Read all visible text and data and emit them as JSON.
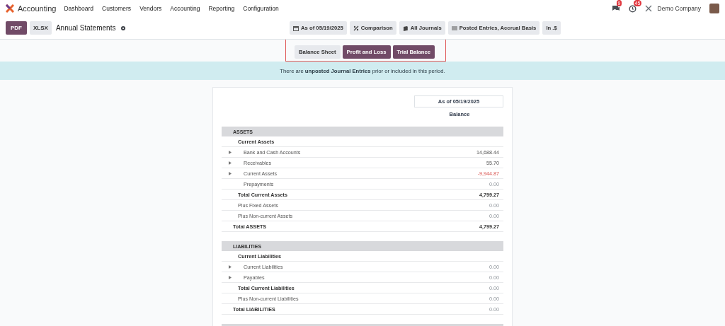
{
  "navbar": {
    "app_name": "Accounting",
    "menu": [
      "Dashboard",
      "Customers",
      "Vendors",
      "Accounting",
      "Reporting",
      "Configuration"
    ],
    "message_badge": "9",
    "activity_badge": "45",
    "company": "Demo Company"
  },
  "control_panel": {
    "buttons": [
      {
        "label": "PDF",
        "primary": true
      },
      {
        "label": "XLSX",
        "primary": false
      }
    ],
    "title": "Annual Statements",
    "filters": [
      {
        "label": "As of 05/19/2025",
        "kind": "date"
      },
      {
        "label": "Comparison",
        "kind": "comparison"
      },
      {
        "label": "All Journals",
        "kind": "journals"
      },
      {
        "label": "Posted Entries, Accrual Basis",
        "kind": "options"
      },
      {
        "label": "In .$",
        "kind": "currency"
      }
    ]
  },
  "report_tabs": [
    {
      "label": "Balance Sheet",
      "highlighted": false
    },
    {
      "label": "Profit and Loss",
      "highlighted": true
    },
    {
      "label": "Trial Balance",
      "highlighted": true
    }
  ],
  "banner": "There are **unposted Journal Entries** prior or included in this period.",
  "report": {
    "column_period": "As of 05/19/2025",
    "column_label": "Balance",
    "sections": [
      {
        "title": "ASSETS",
        "rows": [
          {
            "kind": "subheader",
            "label": "Current Assets"
          },
          {
            "kind": "account",
            "label": "Bank and Cash Accounts",
            "value": "14,688.44",
            "negative": false,
            "muted": false
          },
          {
            "kind": "account",
            "label": "Receivables",
            "value": "55.70",
            "negative": false,
            "muted": false
          },
          {
            "kind": "account",
            "label": "Current Assets",
            "value": "-9,944.87",
            "negative": true,
            "muted": false
          },
          {
            "kind": "leaf",
            "label": "Prepayments",
            "value": "0.00",
            "negative": false,
            "muted": true
          },
          {
            "kind": "total",
            "label": "Total Current Assets",
            "value": "4,799.27",
            "negative": false,
            "muted": false
          },
          {
            "kind": "line",
            "label": "Plus Fixed Assets",
            "value": "0.00",
            "negative": false,
            "muted": true
          },
          {
            "kind": "line",
            "label": "Plus Non-current Assets",
            "value": "0.00",
            "negative": false,
            "muted": true
          },
          {
            "kind": "grand",
            "label": "Total ASSETS",
            "value": "4,799.27",
            "negative": false,
            "muted": false
          }
        ]
      },
      {
        "title": "LIABILITIES",
        "rows": [
          {
            "kind": "subheader",
            "label": "Current Liabilities"
          },
          {
            "kind": "account",
            "label": "Current Liabilities",
            "value": "0.00",
            "negative": false,
            "muted": true
          },
          {
            "kind": "account",
            "label": "Payables",
            "value": "0.00",
            "negative": false,
            "muted": true
          },
          {
            "kind": "total",
            "label": "Total Current Liabilities",
            "value": "0.00",
            "negative": false,
            "muted": true
          },
          {
            "kind": "line",
            "label": "Plus Non-current Liabilities",
            "value": "0.00",
            "negative": false,
            "muted": true
          },
          {
            "kind": "grand",
            "label": "Total LIABILITIES",
            "value": "0.00",
            "negative": false,
            "muted": true
          }
        ]
      }
    ]
  }
}
